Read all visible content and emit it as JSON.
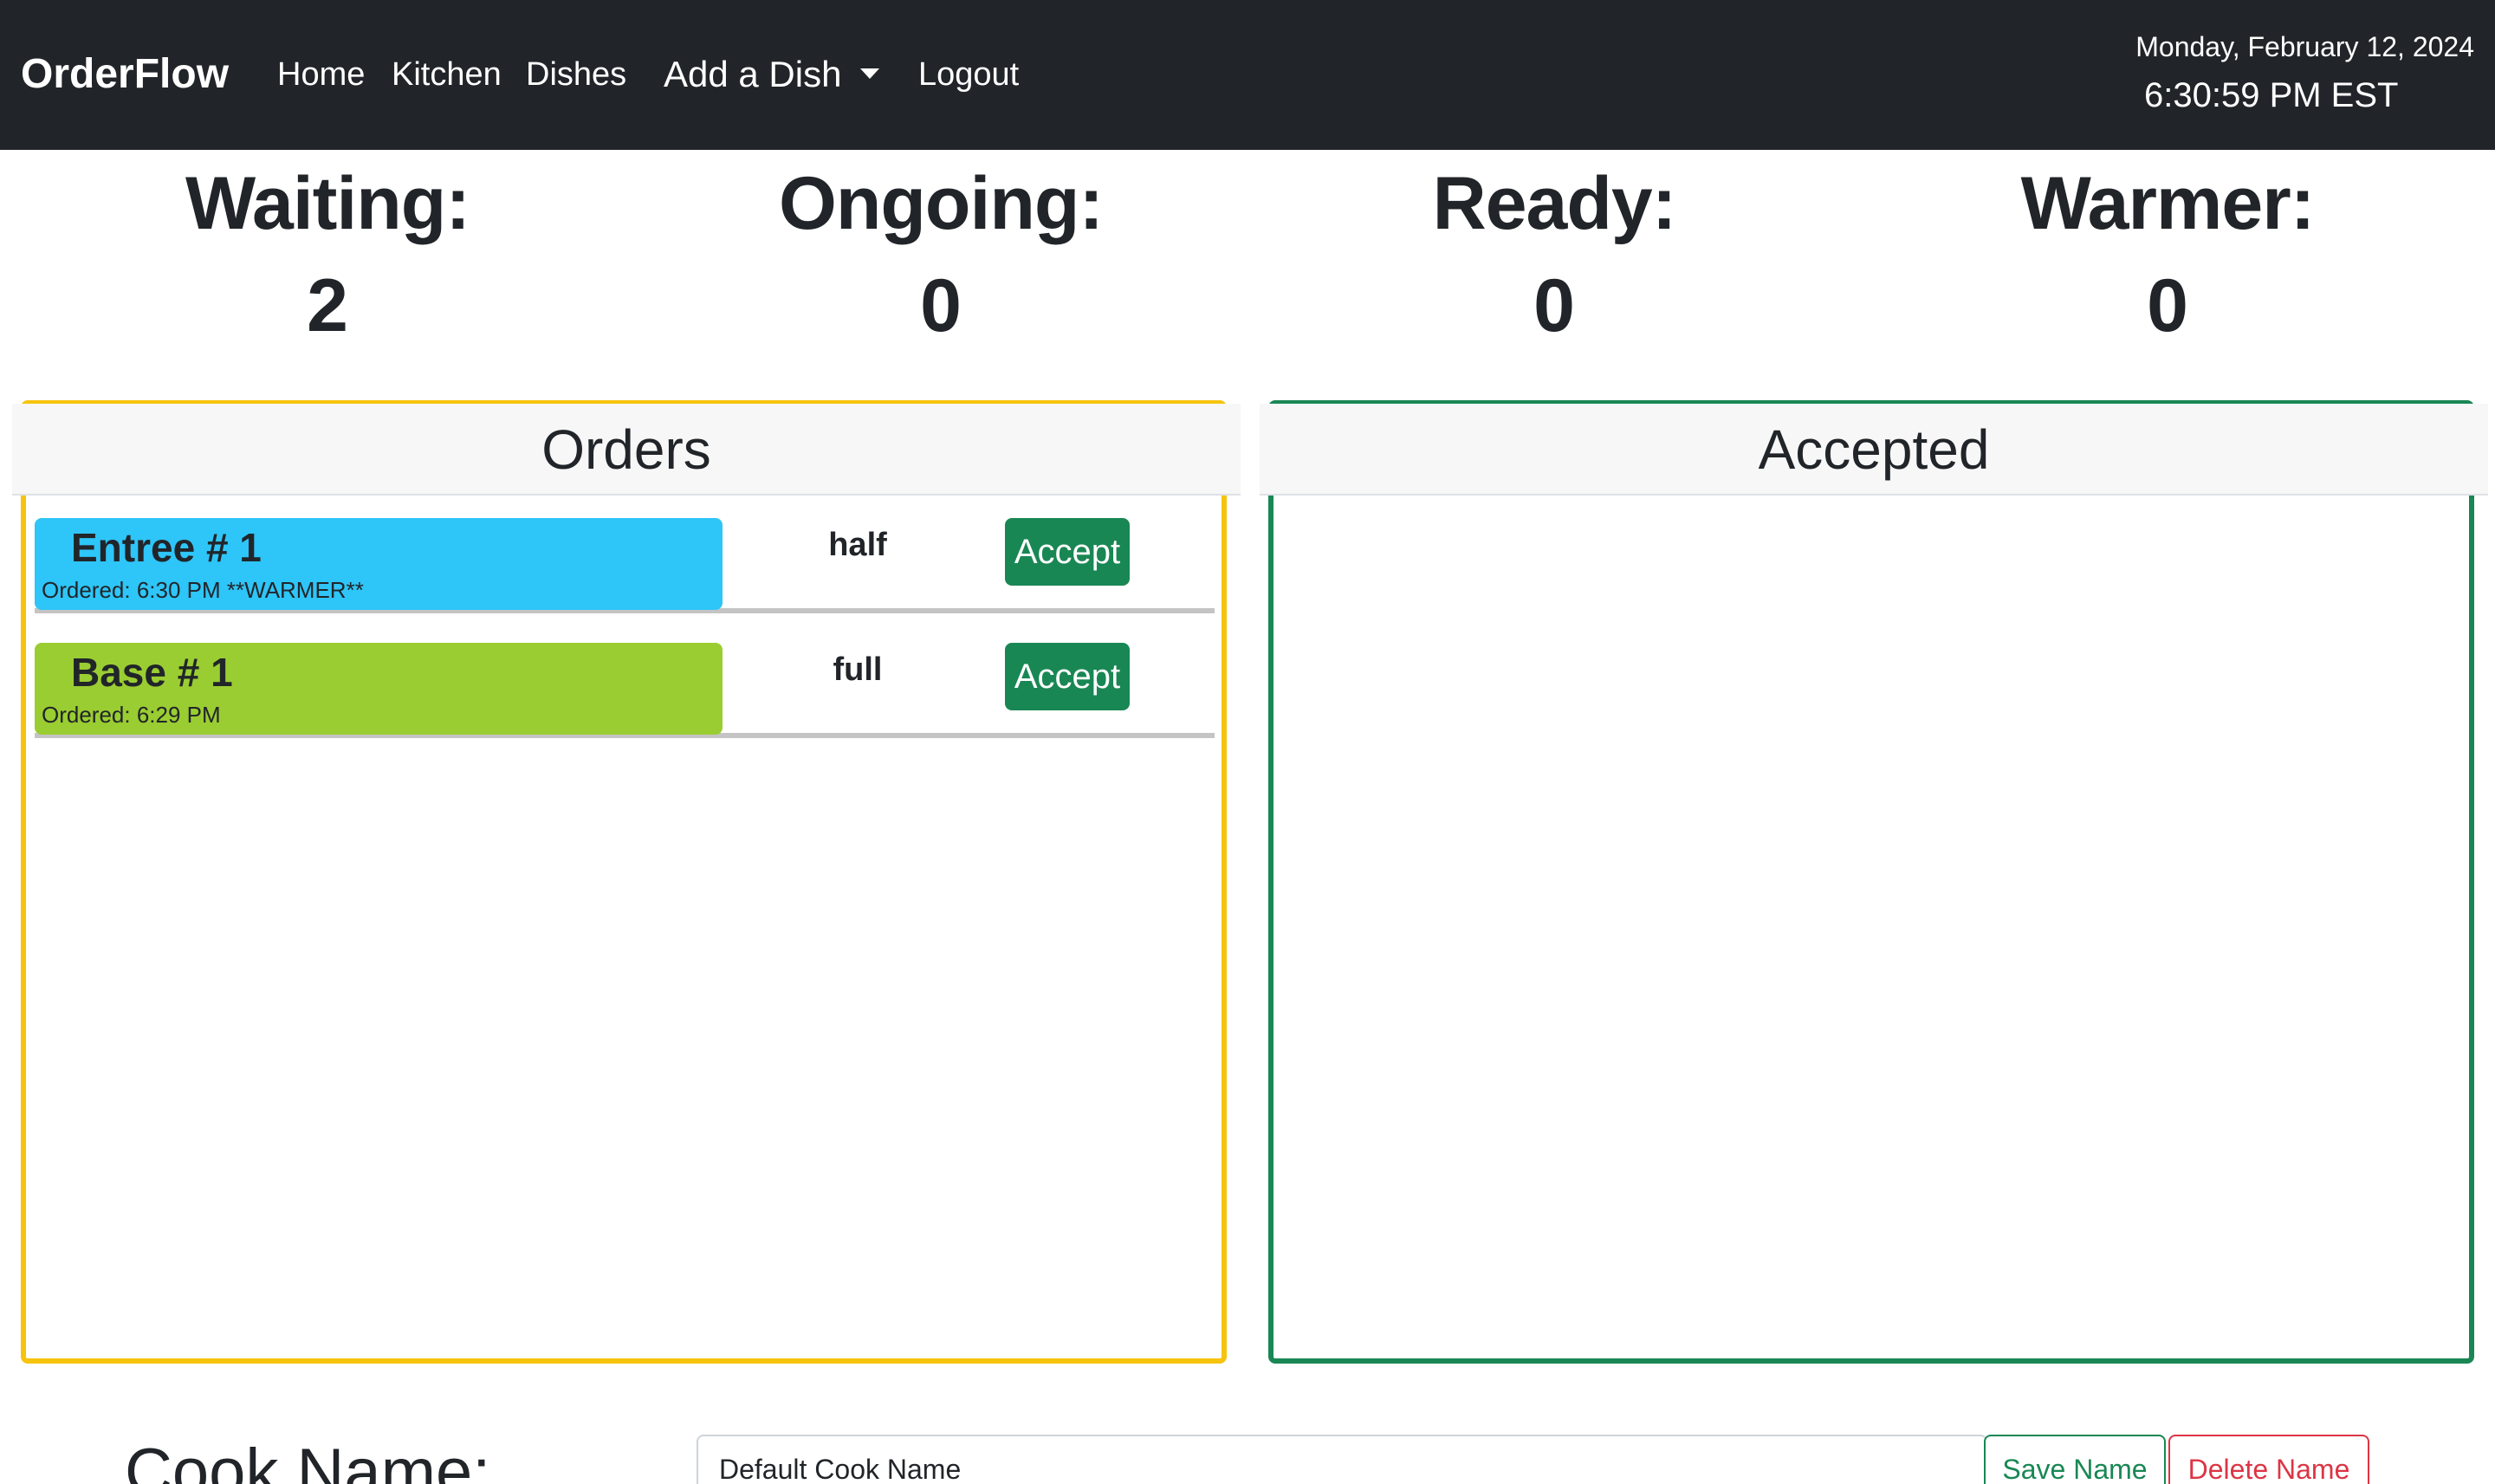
{
  "navbar": {
    "brand": "OrderFlow",
    "links": {
      "home": "Home",
      "kitchen": "Kitchen",
      "dishes": "Dishes",
      "add_dish": "Add a Dish",
      "logout": "Logout"
    },
    "date": "Monday, February 12, 2024",
    "time": "6:30:59 PM EST"
  },
  "stats": [
    {
      "label": "Waiting:",
      "value": "2"
    },
    {
      "label": "Ongoing:",
      "value": "0"
    },
    {
      "label": "Ready:",
      "value": "0"
    },
    {
      "label": "Warmer:",
      "value": "0"
    }
  ],
  "orders_panel": {
    "title": "Orders",
    "items": [
      {
        "name": "Entree # 1",
        "ordered": "Ordered: 6:30 PM **WARMER**",
        "size": "half",
        "action": "Accept",
        "color": "#2ec5f8"
      },
      {
        "name": "Base # 1",
        "ordered": "Ordered: 6:29 PM",
        "size": "full",
        "action": "Accept",
        "color": "#9acd32"
      }
    ],
    "border_color": "#f6c40e"
  },
  "accepted_panel": {
    "title": "Accepted",
    "border_color": "#198754"
  },
  "cook": {
    "label": "Cook Name:",
    "input_value": "Default Cook Name",
    "save_label": "Save Name",
    "delete_label": "Delete Name"
  },
  "colors": {
    "navbar_bg": "#212529",
    "accept_button": "#198754",
    "delete_button": "#dc3545"
  }
}
